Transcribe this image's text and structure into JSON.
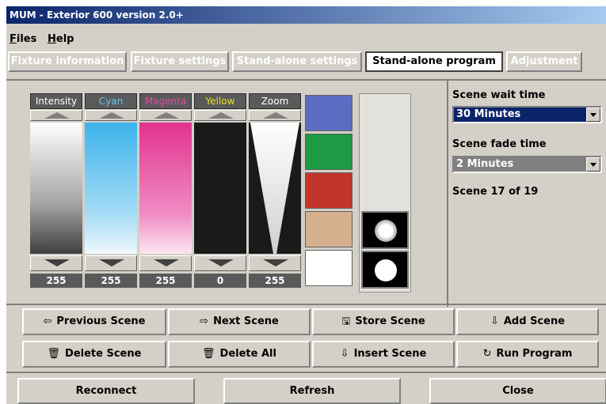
{
  "window": {
    "title": "MUM - Exterior 600 version 2.0+"
  },
  "menu": {
    "files_label": "Files",
    "files_u": "F",
    "files_rest": "iles",
    "help_u": "H",
    "help_rest": "elp"
  },
  "tabs": [
    {
      "label": "Fixture information",
      "active": false
    },
    {
      "label": "Fixture settings",
      "active": false
    },
    {
      "label": "Stand-alone settings",
      "active": false
    },
    {
      "label": "Stand-alone program",
      "active": true
    },
    {
      "label": "Adjustment",
      "active": false
    }
  ],
  "channels": [
    {
      "label": "Intensity",
      "value": "255",
      "label_color": "#ffffff"
    },
    {
      "label": "Cyan",
      "value": "255",
      "label_color": "#5fc8f0"
    },
    {
      "label": "Magenta",
      "value": "255",
      "label_color": "#e44aa5"
    },
    {
      "label": "Yellow",
      "value": "0",
      "label_color": "#e8e020"
    },
    {
      "label": "Zoom",
      "value": "255",
      "label_color": "#ffffff"
    }
  ],
  "color_swatches": [
    "#5b6cc2",
    "#1f9a44",
    "#c23528",
    "#d6b08e",
    "#ffffff"
  ],
  "gobo_count": 2,
  "scene": {
    "wait_label": "Scene wait time",
    "wait_value": "30 Minutes",
    "fade_label": "Scene fade time",
    "fade_value": "2 Minutes",
    "position": "Scene 17 of 19"
  },
  "buttons": {
    "previous_scene": "Previous Scene",
    "next_scene": "Next Scene",
    "store_scene": "Store Scene",
    "add_scene": "Add Scene",
    "delete_scene": "Delete Scene",
    "delete_all": "Delete All",
    "insert_scene": "Insert Scene",
    "run_program": "Run Program",
    "reconnect": "Reconnect",
    "refresh": "Refresh",
    "close": "Close"
  },
  "icons": {
    "previous_scene": "left-arrow-icon",
    "next_scene": "right-arrow-icon",
    "store_scene": "store-disk-icon",
    "add_scene": "add-arrow-icon",
    "delete_scene": "trash-icon",
    "delete_all": "trash-all-icon",
    "insert_scene": "insert-arrow-icon",
    "run_program": "refresh-cycle-icon"
  }
}
